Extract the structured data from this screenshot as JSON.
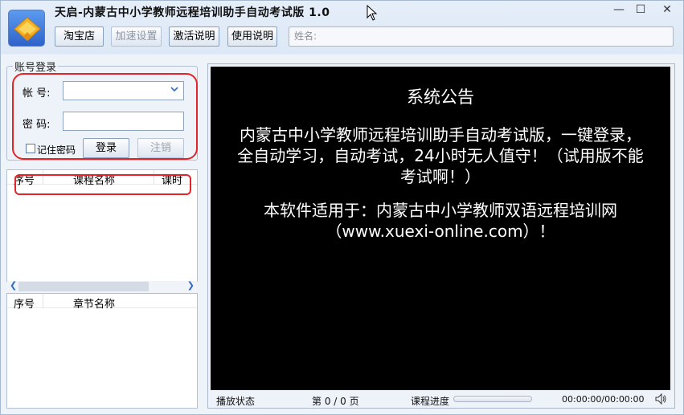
{
  "window": {
    "title": "天启-内蒙古中小学教师远程培训助手自动考试版 1.0",
    "controls": {
      "minimize": "—",
      "maximize": "☐",
      "close": "✕"
    }
  },
  "toolbar": {
    "taobao_label": "淘宝店",
    "speed_label": "加速设置",
    "activate_label": "激活说明",
    "usage_label": "使用说明",
    "name_field_label": "姓名:"
  },
  "login": {
    "group_title": "账号登录",
    "account_label": "帐  号:",
    "account_value": "",
    "password_label": "密  码:",
    "password_value": "",
    "remember_label": "记住密码",
    "remember_checked": false,
    "login_button": "登录",
    "logout_button": "注销"
  },
  "course_list": {
    "columns": [
      "序号",
      "课程名称",
      "课时"
    ],
    "rows": []
  },
  "chapter_list": {
    "columns": [
      "序号",
      "章节名称"
    ],
    "rows": []
  },
  "notice": {
    "title": "系统公告",
    "paragraph1": "内蒙古中小学教师远程培训助手自动考试版，一键登录，全自动学习，自动考试，24小时无人值守！（试用版不能考试啊！）",
    "paragraph2": "本软件适用于：内蒙古中小学教师双语远程培训网（www.xuexi-online.com）！"
  },
  "status": {
    "play_state_label": "播放状态",
    "page_text": "第 0 / 0 页",
    "progress_label": "课程进度",
    "progress_value": 0,
    "time_text": "00:00:00/00:00:00"
  },
  "colors": {
    "window_bg": "#eef3fa",
    "notice_bg": "#000000",
    "notice_text": "#ffffff",
    "highlight": "#e0262a",
    "accent": "#2f6bc6"
  },
  "icons": {
    "logo": "app-logo-icon",
    "cursor": "mouse-cursor-icon",
    "dropdown": "chevron-down-icon",
    "speaker": "speaker-icon"
  }
}
